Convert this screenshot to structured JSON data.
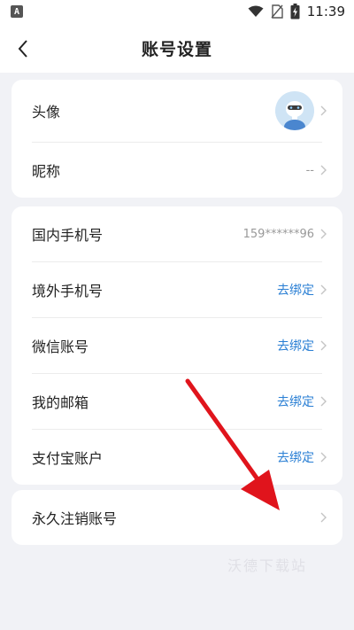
{
  "status_bar": {
    "left_icon_label": "A",
    "time": "11:39",
    "icons": [
      "wifi-icon",
      "no-sim-icon",
      "battery-icon"
    ]
  },
  "header": {
    "title": "账号设置",
    "back_icon": "back-chevron-icon"
  },
  "profile_card": {
    "avatar_label": "头像",
    "nickname_label": "昵称",
    "nickname_value": "--"
  },
  "bindings_card": {
    "items": [
      {
        "label": "国内手机号",
        "value": "159******96",
        "is_link": false
      },
      {
        "label": "境外手机号",
        "value": "去绑定",
        "is_link": true
      },
      {
        "label": "微信账号",
        "value": "去绑定",
        "is_link": true
      },
      {
        "label": "我的邮箱",
        "value": "去绑定",
        "is_link": true
      },
      {
        "label": "支付宝账户",
        "value": "去绑定",
        "is_link": true
      }
    ]
  },
  "danger_card": {
    "label": "永久注销账号"
  },
  "watermark": "沃德下载站",
  "colors": {
    "background": "#f1f2f6",
    "card": "#ffffff",
    "link": "#2a7fd4",
    "annotation_arrow": "#e0141c"
  }
}
